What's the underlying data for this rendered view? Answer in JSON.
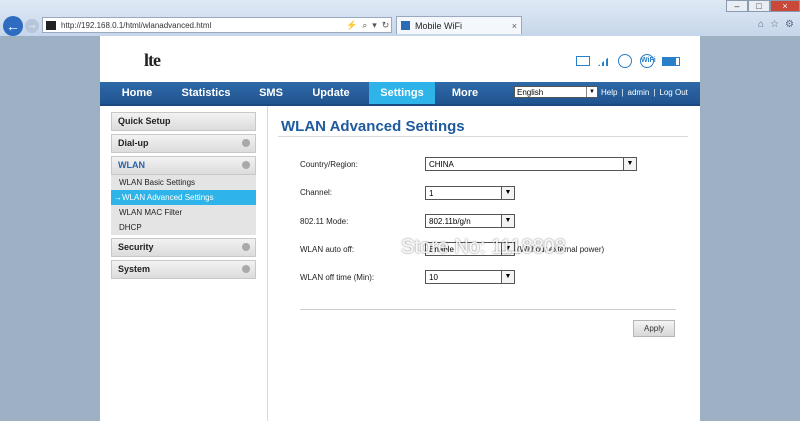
{
  "browser": {
    "address": "http://192.168.0.1/html/wlanadvanced.html",
    "tab_title": "Mobile WiFi",
    "tab_close": "×",
    "back": "←",
    "forward": "→",
    "minimize": "–",
    "maximize": "□",
    "close": "×"
  },
  "header": {
    "logo": "lte",
    "icons": [
      "mail-icon",
      "signal-icon",
      "globe-icon",
      "wifi-icon",
      "battery-icon"
    ],
    "wifi_text": "WiFi"
  },
  "nav": {
    "items": [
      "Home",
      "Statistics",
      "SMS",
      "Update",
      "Settings",
      "More"
    ],
    "active": "Settings",
    "language": "English",
    "help": "Help",
    "sep": "|",
    "user": "admin",
    "logout": "Log Out"
  },
  "sidebar": {
    "quick_setup": "Quick Setup",
    "dialup": "Dial-up",
    "wlan": "WLAN",
    "wlan_items": [
      "WLAN Basic Settings",
      "→WLAN Advanced Settings",
      "WLAN MAC Filter",
      "DHCP"
    ],
    "security": "Security",
    "system": "System"
  },
  "main": {
    "title": "WLAN Advanced Settings",
    "country_label": "Country/Region:",
    "country_value": "CHINA",
    "channel_label": "Channel:",
    "channel_value": "1",
    "mode_label": "802.11 Mode:",
    "mode_value": "802.11b/g/n",
    "autooff_label": "WLAN auto off:",
    "autooff_value": "Enable",
    "autooff_note": "(Without external power)",
    "offtime_label": "WLAN off time (Min):",
    "offtime_value": "10",
    "apply": "Apply"
  },
  "watermark": "Store No: 1118808",
  "colors": {
    "nav_bg": "#1f5390",
    "active_tab": "#2eb4e8",
    "title": "#1f5a9c"
  }
}
